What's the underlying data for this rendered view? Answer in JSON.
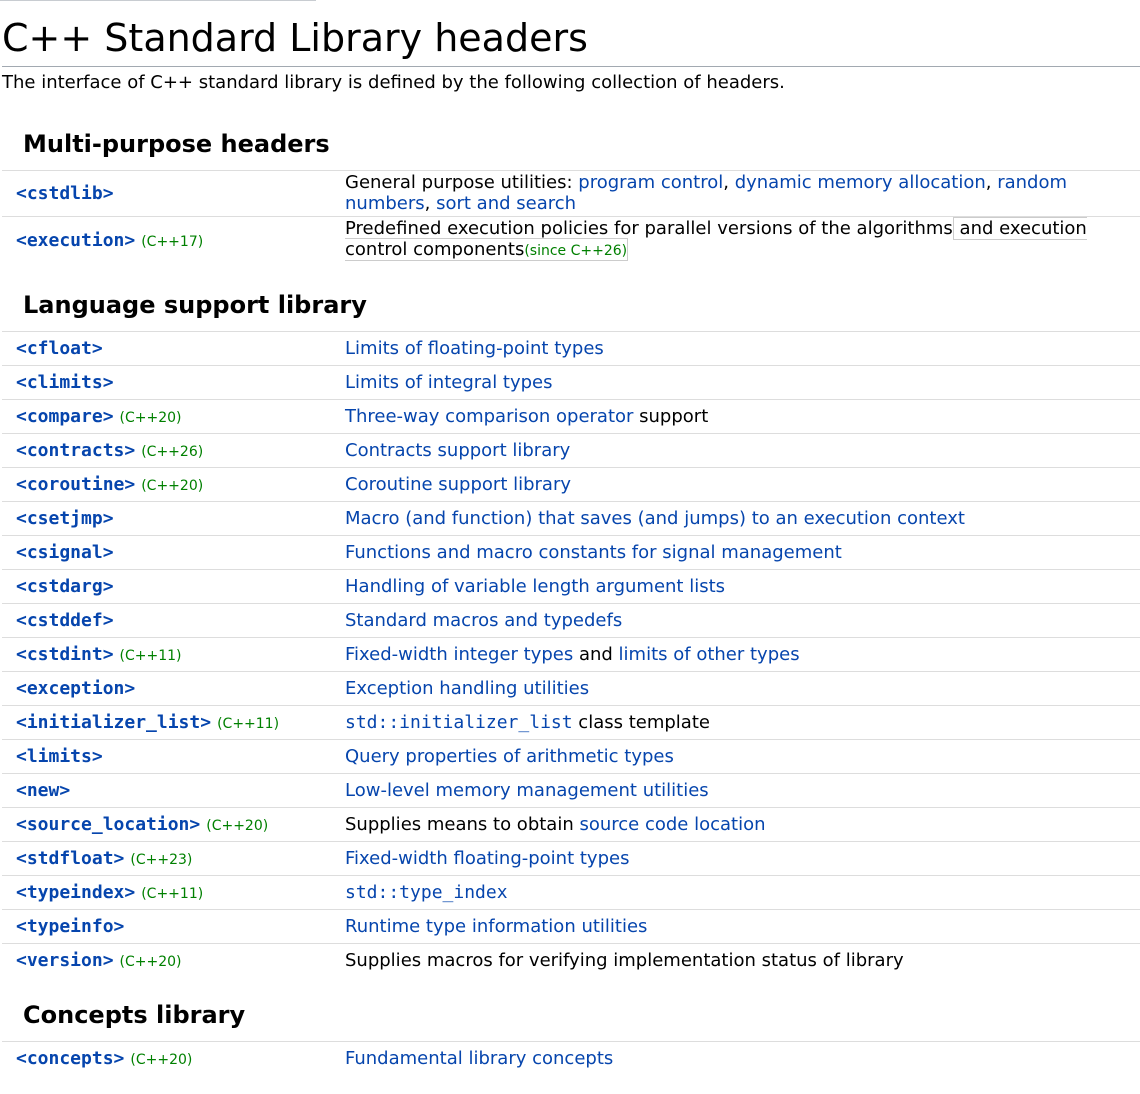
{
  "title": "C++ Standard Library headers",
  "intro": "The interface of C++ standard library is defined by the following collection of headers.",
  "sections": {
    "multi": {
      "heading": "Multi-purpose headers",
      "cstdlib": {
        "name": "<cstdlib>",
        "desc_prefix": "General purpose utilities: ",
        "link1": "program control",
        "sep1": ", ",
        "link2": "dynamic memory allocation",
        "sep2": ", ",
        "link3": "random numbers",
        "sep3": ", ",
        "link4": "sort and search"
      },
      "execution": {
        "name": "<execution>",
        "version": "(C++17)",
        "desc_part1": "Predefined execution policies for parallel versions of the algorithms",
        "desc_part2": " and execution control components",
        "since": "(since C++26)"
      }
    },
    "language": {
      "heading": "Language support library",
      "rows": [
        {
          "name": "<cfloat>",
          "version": "",
          "link": "Limits of floating-point types",
          "text": ""
        },
        {
          "name": "<climits>",
          "version": "",
          "link": "Limits of integral types",
          "text": ""
        },
        {
          "name": "<compare>",
          "version": "(C++20)",
          "link": "Three-way comparison operator",
          "text": " support"
        },
        {
          "name": "<contracts>",
          "version": "(C++26)",
          "link": "Contracts support library",
          "text": ""
        },
        {
          "name": "<coroutine>",
          "version": "(C++20)",
          "link": "Coroutine support library",
          "text": ""
        },
        {
          "name": "<csetjmp>",
          "version": "",
          "link": "Macro (and function) that saves (and jumps) to an execution context",
          "text": ""
        },
        {
          "name": "<csignal>",
          "version": "",
          "link": "Functions and macro constants for signal management",
          "text": ""
        },
        {
          "name": "<cstdarg>",
          "version": "",
          "link": "Handling of variable length argument lists",
          "text": ""
        },
        {
          "name": "<cstddef>",
          "version": "",
          "link": "Standard macros and typedefs",
          "text": ""
        }
      ],
      "cstdint": {
        "name": "<cstdint>",
        "version": "(C++11)",
        "link1": "Fixed-width integer types",
        "mid": " and ",
        "link2": "limits of other types"
      },
      "exception": {
        "name": "<exception>",
        "link": "Exception handling utilities"
      },
      "initializer_list": {
        "name": "<initializer_list>",
        "version": "(C++11)",
        "code": "std::initializer_list",
        "text": " class template"
      },
      "rows2": [
        {
          "name": "<limits>",
          "version": "",
          "link": "Query properties of arithmetic types"
        },
        {
          "name": "<new>",
          "version": "",
          "link": "Low-level memory management utilities"
        }
      ],
      "source_location": {
        "name": "<source_location>",
        "version": "(C++20)",
        "text": "Supplies means to obtain ",
        "link": "source code location"
      },
      "stdfloat": {
        "name": "<stdfloat>",
        "version": "(C++23)",
        "link": "Fixed-width floating-point types"
      },
      "typeindex": {
        "name": "<typeindex>",
        "version": "(C++11)",
        "code": "std::type_index"
      },
      "typeinfo": {
        "name": "<typeinfo>",
        "link": "Runtime type information utilities"
      },
      "version_row": {
        "name": "<version>",
        "version": "(C++20)",
        "text": "Supplies macros for verifying implementation status of library"
      }
    },
    "concepts": {
      "heading": "Concepts library",
      "concepts_row": {
        "name": "<concepts>",
        "version": "(C++20)",
        "link": "Fundamental library concepts"
      }
    }
  }
}
